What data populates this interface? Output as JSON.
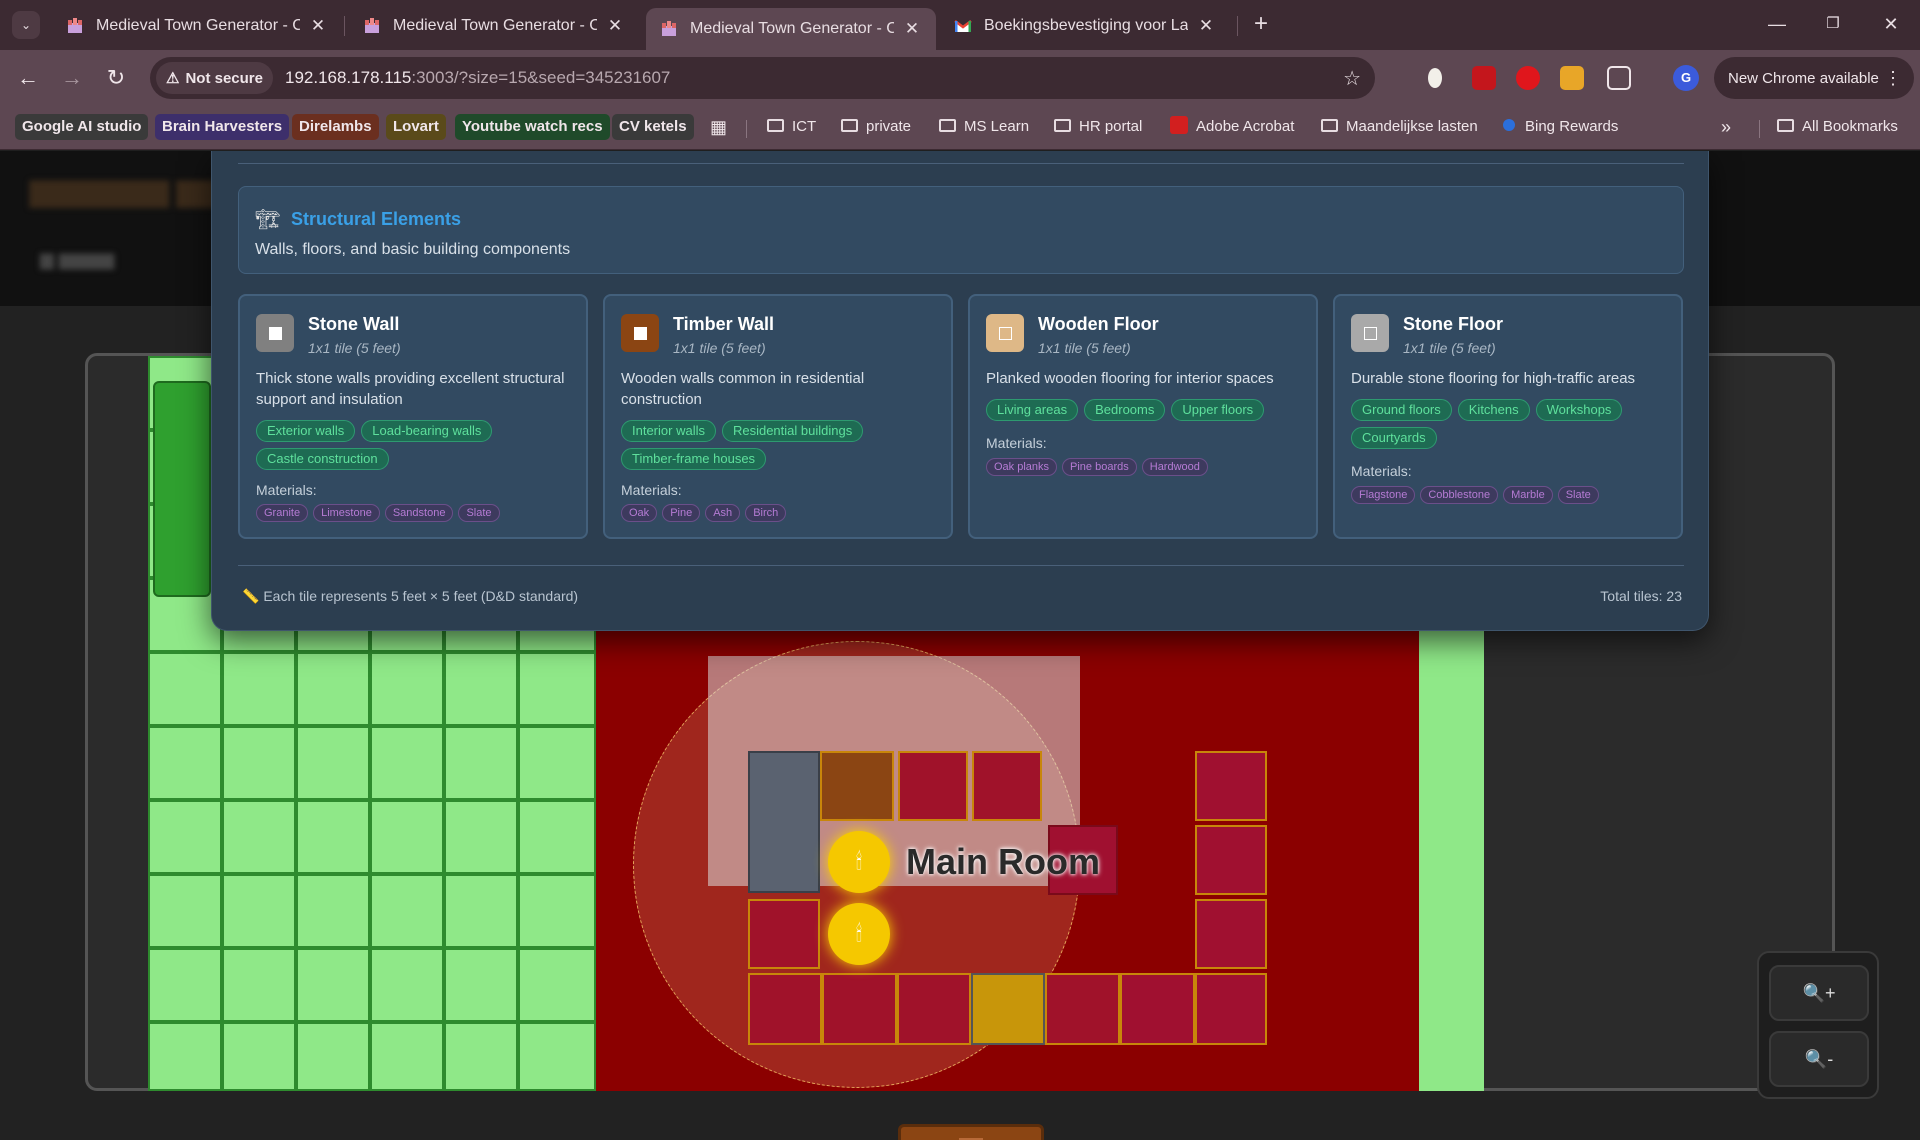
{
  "browser": {
    "tabs": [
      {
        "title": "Medieval Town Generator - Create",
        "active": false
      },
      {
        "title": "Medieval Town Generator - Create",
        "active": false
      },
      {
        "title": "Medieval Town Generator - Create",
        "active": true
      },
      {
        "title": "Boekingsbevestiging voor Land",
        "active": false
      }
    ],
    "new_tab_symbol": "+",
    "security_label": "Not secure",
    "url_host": "192.168.178.115",
    "url_rest": ":3003/?size=15&seed=345231607",
    "profile_initial": "G",
    "update_label": "New Chrome available"
  },
  "bookmarks": {
    "pills": [
      {
        "label": "Google AI studio",
        "color": "#3a3a3a"
      },
      {
        "label": "Brain Harvesters",
        "color": "#3d2f6b"
      },
      {
        "label": "Direlambs",
        "color": "#6b2f1f"
      },
      {
        "label": "Lovart",
        "color": "#5a4a1a"
      },
      {
        "label": "Youtube watch recs",
        "color": "#1f4a2a"
      },
      {
        "label": "CV ketels",
        "color": "#3a3a3a"
      }
    ],
    "folders": [
      "ICT",
      "private",
      "MS Learn",
      "HR portal"
    ],
    "adobe": "Adobe Acrobat",
    "folder2": "Maandelijkse lasten",
    "bing": "Bing Rewards",
    "more": "»",
    "all": "All Bookmarks"
  },
  "panel": {
    "category": {
      "icon": "🏗",
      "title": "Structural Elements",
      "description": "Walls, floors, and basic building components"
    },
    "cards": [
      {
        "name": "Stone Wall",
        "size": "1x1 tile (5 feet)",
        "description": "Thick stone walls providing excellent structural support and insulation",
        "swatch_color": "#808080",
        "tags": [
          "Exterior walls",
          "Load-bearing walls",
          "Castle construction"
        ],
        "materials_label": "Materials:",
        "materials": [
          "Granite",
          "Limestone",
          "Sandstone",
          "Slate"
        ]
      },
      {
        "name": "Timber Wall",
        "size": "1x1 tile (5 feet)",
        "description": "Wooden walls common in residential construction",
        "swatch_color": "#8b4513",
        "tags": [
          "Interior walls",
          "Residential buildings",
          "Timber-frame houses"
        ],
        "materials_label": "Materials:",
        "materials": [
          "Oak",
          "Pine",
          "Ash",
          "Birch"
        ]
      },
      {
        "name": "Wooden Floor",
        "size": "1x1 tile (5 feet)",
        "description": "Planked wooden flooring for interior spaces",
        "swatch_color": "#deb887",
        "tags": [
          "Living areas",
          "Bedrooms",
          "Upper floors"
        ],
        "materials_label": "Materials:",
        "materials": [
          "Oak planks",
          "Pine boards",
          "Hardwood"
        ]
      },
      {
        "name": "Stone Floor",
        "size": "1x1 tile (5 feet)",
        "description": "Durable stone flooring for high-traffic areas",
        "swatch_color": "#a9a9a9",
        "tags": [
          "Ground floors",
          "Kitchens",
          "Workshops",
          "Courtyards"
        ],
        "materials_label": "Materials:",
        "materials": [
          "Flagstone",
          "Cobblestone",
          "Marble",
          "Slate"
        ]
      }
    ],
    "footer_note": "📏 Each tile represents 5 feet × 5 feet (D&D standard)",
    "footer_total": "Total tiles: 23"
  },
  "map": {
    "room_label": "Main Room",
    "zoom_in": "🔍+",
    "zoom_out": "🔍-"
  }
}
